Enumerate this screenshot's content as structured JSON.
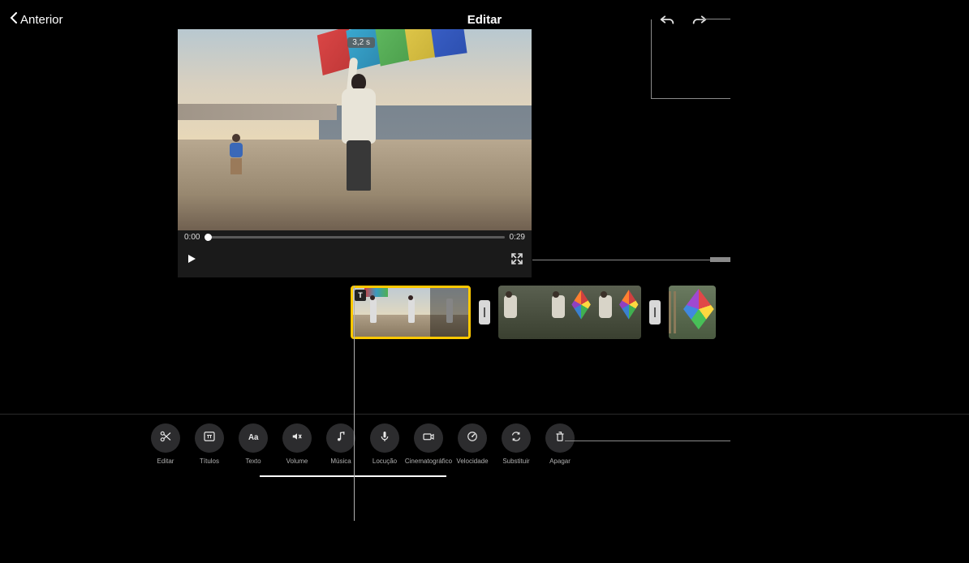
{
  "header": {
    "back_label": "Anterior",
    "title": "Editar"
  },
  "viewer": {
    "duration_badge": "3,2 s",
    "time_current": "0:00",
    "time_total": "0:29"
  },
  "toolbar": {
    "items": [
      {
        "name": "editar",
        "label": "Editar",
        "icon": "scissors"
      },
      {
        "name": "titulos",
        "label": "Títulos",
        "icon": "title-template"
      },
      {
        "name": "texto",
        "label": "Texto",
        "icon": "text"
      },
      {
        "name": "volume",
        "label": "Volume",
        "icon": "speaker-mute"
      },
      {
        "name": "musica",
        "label": "Música",
        "icon": "music-note"
      },
      {
        "name": "locucao",
        "label": "Locução",
        "icon": "microphone"
      },
      {
        "name": "cinematografico",
        "label": "Cinematográfico",
        "icon": "camera"
      },
      {
        "name": "velocidade",
        "label": "Velocidade",
        "icon": "speedometer"
      },
      {
        "name": "substituir",
        "label": "Substituir",
        "icon": "replace"
      },
      {
        "name": "apagar",
        "label": "Apagar",
        "icon": "trash"
      }
    ]
  }
}
